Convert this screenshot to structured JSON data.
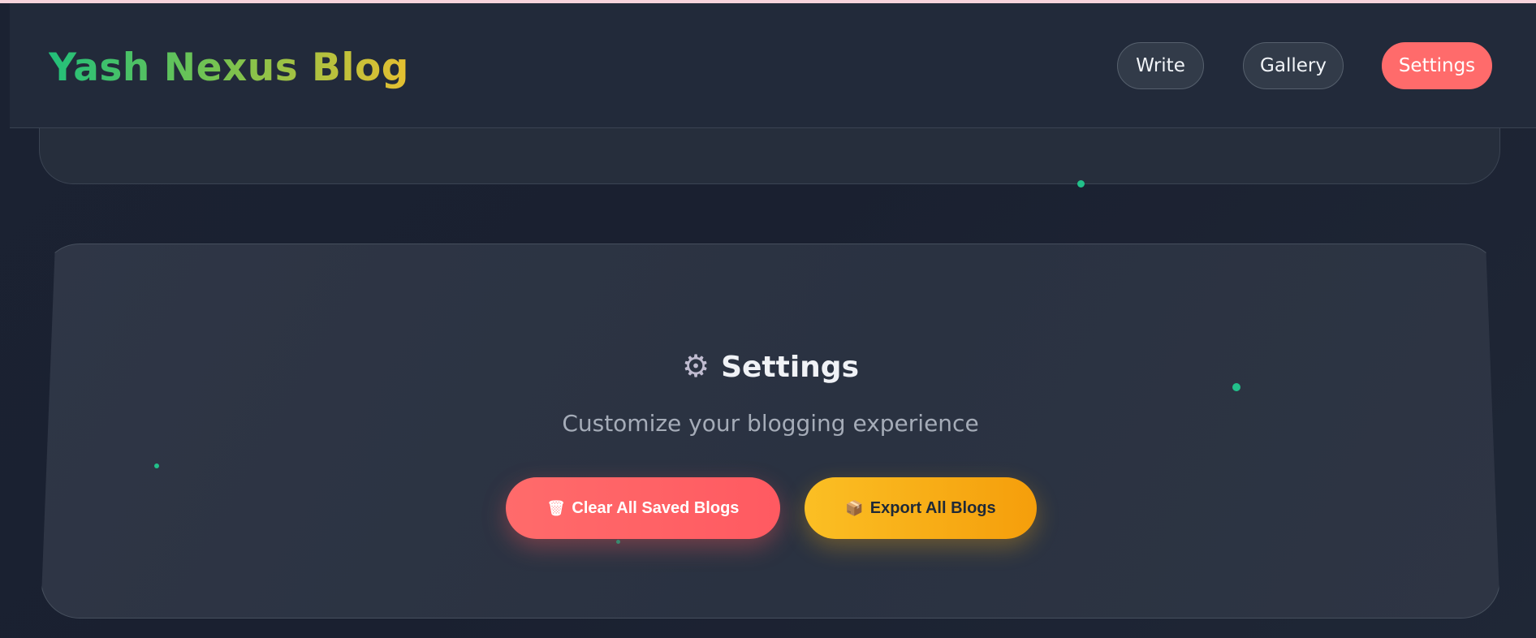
{
  "header": {
    "brand": "Yash Nexus Blog",
    "nav": {
      "write": "Write",
      "gallery": "Gallery",
      "settings": "Settings"
    }
  },
  "settings_panel": {
    "icon": "gear-icon",
    "icon_glyph": "⚙",
    "title": "Settings",
    "subtitle": "Customize your blogging experience",
    "clear_button": {
      "icon": "trash-icon",
      "icon_glyph": "🗑",
      "label": "Clear All Saved Blogs"
    },
    "export_button": {
      "icon": "package-icon",
      "icon_glyph": "📦",
      "label": "Export All Blogs"
    }
  },
  "colors": {
    "accent_red": "#ff6b6b",
    "accent_yellow": "#fbbf24",
    "accent_green": "#22c08a",
    "background": "#1a2130"
  }
}
